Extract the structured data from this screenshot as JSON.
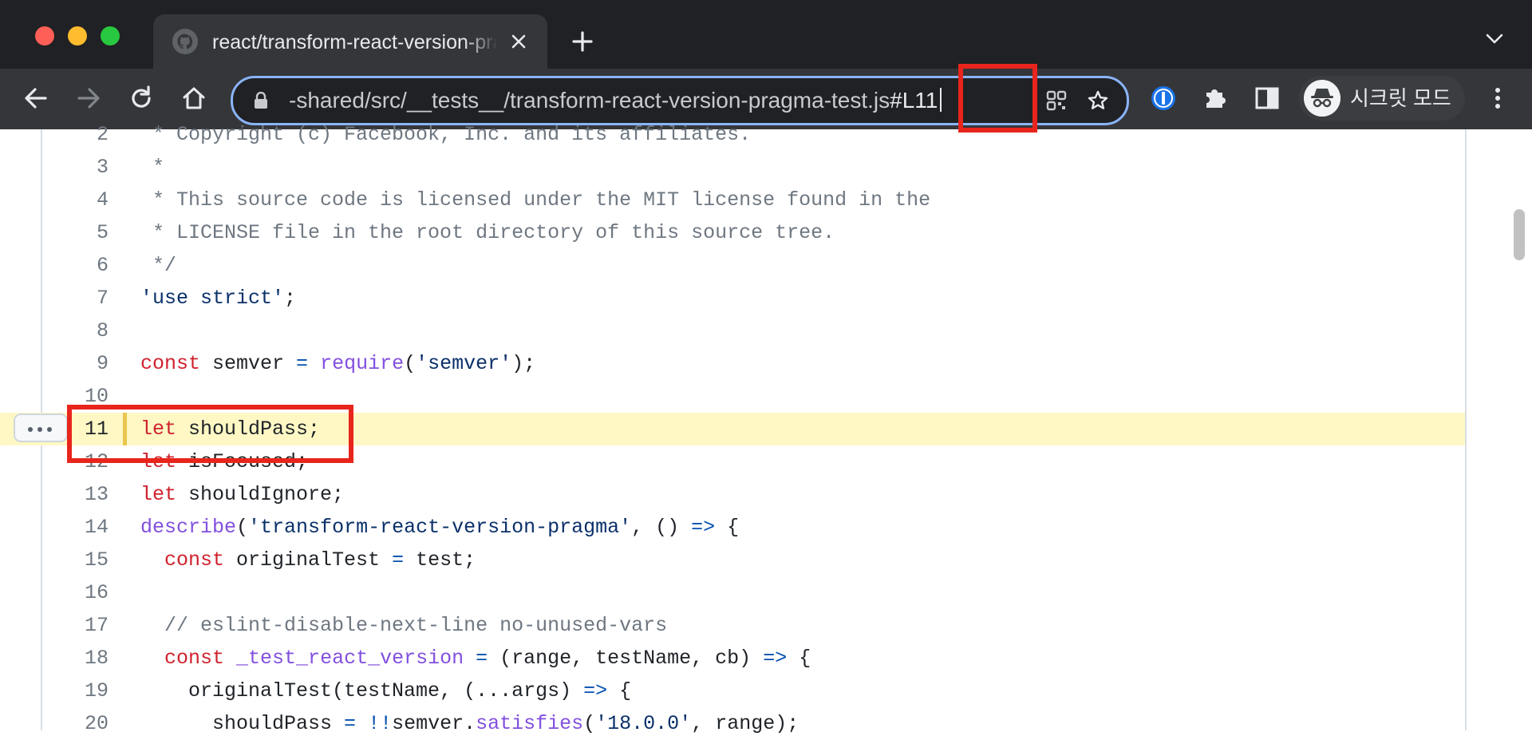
{
  "browser": {
    "tab": {
      "title": "react/transform-react-version-pragma-test.js at main · facebook/react"
    },
    "omnibox": {
      "url_visible": "-shared/src/__tests__/transform-react-version-pragma-test.js",
      "url_hash": "#L11"
    },
    "profile": {
      "label": "시크릿 모드"
    }
  },
  "icons": {
    "tab_favicon": "github-icon",
    "tab_close": "close-icon",
    "new_tab": "plus-icon",
    "tab_search": "chevron-down-icon",
    "back": "arrow-left-icon",
    "forward": "arrow-right-icon",
    "reload": "reload-icon",
    "home": "home-icon",
    "lock": "lock-icon",
    "qr": "qr-code-icon",
    "bookmark": "star-icon",
    "password_manager": "1password-icon",
    "extensions": "puzzle-icon",
    "side_panel": "side-panel-icon",
    "incognito": "incognito-icon",
    "menu": "kebab-menu-icon"
  },
  "colors": {
    "annotation": "#e8251c",
    "highlight_line": "#fff8c5",
    "omnibox_focus": "#8ab4f8",
    "keyword": "#cf222e",
    "string": "#0a3069",
    "function": "#8250df",
    "operator": "#0550ae",
    "comment": "#6e7781"
  },
  "code": {
    "highlighted_line": 11,
    "lines": [
      {
        "num": "2",
        "tokens": [
          {
            "t": " * Copyright (c) Facebook, Inc. and its affiliates.",
            "c": "cm"
          }
        ]
      },
      {
        "num": "3",
        "tokens": [
          {
            "t": " *",
            "c": "cm"
          }
        ]
      },
      {
        "num": "4",
        "tokens": [
          {
            "t": " * This source code is licensed under the MIT license found in the",
            "c": "cm"
          }
        ]
      },
      {
        "num": "5",
        "tokens": [
          {
            "t": " * LICENSE file in the root directory of this source tree.",
            "c": "cm"
          }
        ]
      },
      {
        "num": "6",
        "tokens": [
          {
            "t": " */",
            "c": "cm"
          }
        ]
      },
      {
        "num": "7",
        "tokens": [
          {
            "t": "'use strict'",
            "c": "str"
          },
          {
            "t": ";",
            "c": ""
          }
        ]
      },
      {
        "num": "8",
        "tokens": []
      },
      {
        "num": "9",
        "tokens": [
          {
            "t": "const",
            "c": "kw"
          },
          {
            "t": " semver ",
            "c": ""
          },
          {
            "t": "=",
            "c": "op"
          },
          {
            "t": " ",
            "c": ""
          },
          {
            "t": "require",
            "c": "fn"
          },
          {
            "t": "(",
            "c": ""
          },
          {
            "t": "'semver'",
            "c": "str"
          },
          {
            "t": ");",
            "c": ""
          }
        ]
      },
      {
        "num": "10",
        "tokens": []
      },
      {
        "num": "11",
        "tokens": [
          {
            "t": "let",
            "c": "kw"
          },
          {
            "t": " shouldPass;",
            "c": ""
          }
        ]
      },
      {
        "num": "12",
        "tokens": [
          {
            "t": "let",
            "c": "kw"
          },
          {
            "t": " isFocused;",
            "c": ""
          }
        ]
      },
      {
        "num": "13",
        "tokens": [
          {
            "t": "let",
            "c": "kw"
          },
          {
            "t": " shouldIgnore;",
            "c": ""
          }
        ]
      },
      {
        "num": "14",
        "tokens": [
          {
            "t": "describe",
            "c": "fn"
          },
          {
            "t": "(",
            "c": ""
          },
          {
            "t": "'transform-react-version-pragma'",
            "c": "str"
          },
          {
            "t": ", () ",
            "c": ""
          },
          {
            "t": "=>",
            "c": "op"
          },
          {
            "t": " {",
            "c": ""
          }
        ]
      },
      {
        "num": "15",
        "tokens": [
          {
            "t": "  ",
            "c": ""
          },
          {
            "t": "const",
            "c": "kw"
          },
          {
            "t": " originalTest ",
            "c": ""
          },
          {
            "t": "=",
            "c": "op"
          },
          {
            "t": " test;",
            "c": ""
          }
        ]
      },
      {
        "num": "16",
        "tokens": []
      },
      {
        "num": "17",
        "tokens": [
          {
            "t": "  // eslint-disable-next-line no-unused-vars",
            "c": "cm"
          }
        ]
      },
      {
        "num": "18",
        "tokens": [
          {
            "t": "  ",
            "c": ""
          },
          {
            "t": "const",
            "c": "kw"
          },
          {
            "t": " ",
            "c": ""
          },
          {
            "t": "_test_react_version",
            "c": "fn"
          },
          {
            "t": " ",
            "c": ""
          },
          {
            "t": "=",
            "c": "op"
          },
          {
            "t": " (range, testName, cb) ",
            "c": ""
          },
          {
            "t": "=>",
            "c": "op"
          },
          {
            "t": " {",
            "c": ""
          }
        ]
      },
      {
        "num": "19",
        "tokens": [
          {
            "t": "    originalTest(testName, (...args) ",
            "c": ""
          },
          {
            "t": "=>",
            "c": "op"
          },
          {
            "t": " {",
            "c": ""
          }
        ]
      },
      {
        "num": "20",
        "tokens": [
          {
            "t": "      shouldPass ",
            "c": ""
          },
          {
            "t": "=",
            "c": "op"
          },
          {
            "t": " ",
            "c": ""
          },
          {
            "t": "!!",
            "c": "op"
          },
          {
            "t": "semver.",
            "c": ""
          },
          {
            "t": "satisfies",
            "c": "fn"
          },
          {
            "t": "(",
            "c": ""
          },
          {
            "t": "'18.0.0'",
            "c": "str"
          },
          {
            "t": ", range);",
            "c": ""
          }
        ]
      }
    ]
  }
}
